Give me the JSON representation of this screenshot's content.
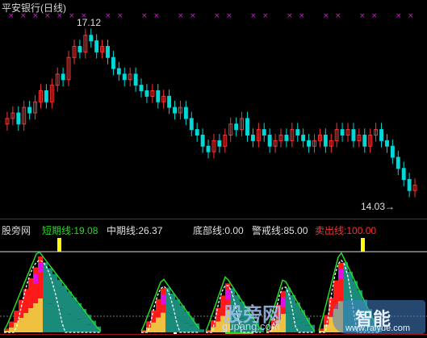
{
  "window": {
    "title": "平安银行(日线)"
  },
  "main_chart": {
    "high_label": "17.12",
    "low_label": "14.03→"
  },
  "indicator": {
    "name": "股旁网",
    "items": [
      {
        "label": "短期线:",
        "value": "19.08",
        "color": "#22dd22"
      },
      {
        "label": "中期线:",
        "value": "26.37",
        "color": "#e0e0e0"
      },
      {
        "label": "底部线:",
        "value": "0.00",
        "color": "#e0e0e0"
      },
      {
        "label": "警戒线:",
        "value": "85.00",
        "color": "#e0e0e0"
      },
      {
        "label": "卖出线:",
        "value": "100.00",
        "color": "#ff3030"
      }
    ]
  },
  "watermark": {
    "text": "股旁网",
    "sub": "gupang.com"
  },
  "logo": {
    "text": "智能",
    "url": "www.raiyue.com"
  },
  "colors": {
    "up": "#ff3232",
    "down": "#00d8d8",
    "marker": "#d020d0",
    "fill_red": "#ff1a1a",
    "fill_yellow": "#f0c040",
    "fill_magenta": "#e010e0",
    "fill_teal": "#1a8a7a",
    "short_line": "#22dd22",
    "white_line": "#ffffff",
    "bar_yellow": "#ffff00",
    "bar_green": "#20e020"
  },
  "chart_data": {
    "type": "candlestick",
    "title": "平安银行(日线)",
    "high": 17.12,
    "low": 14.03,
    "close": [
      15.5,
      15.6,
      15.4,
      15.7,
      15.6,
      15.8,
      16.0,
      15.8,
      16.1,
      16.3,
      16.2,
      16.6,
      16.8,
      16.7,
      17.0,
      16.9,
      16.7,
      16.8,
      16.6,
      16.4,
      16.3,
      16.2,
      16.3,
      16.1,
      16.0,
      15.9,
      16.0,
      15.8,
      15.9,
      15.7,
      15.6,
      15.7,
      15.5,
      15.3,
      15.2,
      15.0,
      14.9,
      15.1,
      15.0,
      15.2,
      15.4,
      15.3,
      15.5,
      15.2,
      15.1,
      15.3,
      15.2,
      15.0,
      15.1,
      15.2,
      15.1,
      15.3,
      15.2,
      15.1,
      15.0,
      15.1,
      15.2,
      15.0,
      15.1,
      15.3,
      15.2,
      15.3,
      15.1,
      15.2,
      15.0,
      15.2,
      15.3,
      15.1,
      15.0,
      14.8,
      14.6,
      14.4,
      14.2,
      14.3
    ],
    "series": [
      {
        "name": "短期线",
        "last": 19.08
      },
      {
        "name": "中期线",
        "last": 26.37
      },
      {
        "name": "底部线",
        "last": 0.0
      },
      {
        "name": "警戒线",
        "last": 85.0
      },
      {
        "name": "卖出线",
        "last": 100.0
      }
    ]
  }
}
